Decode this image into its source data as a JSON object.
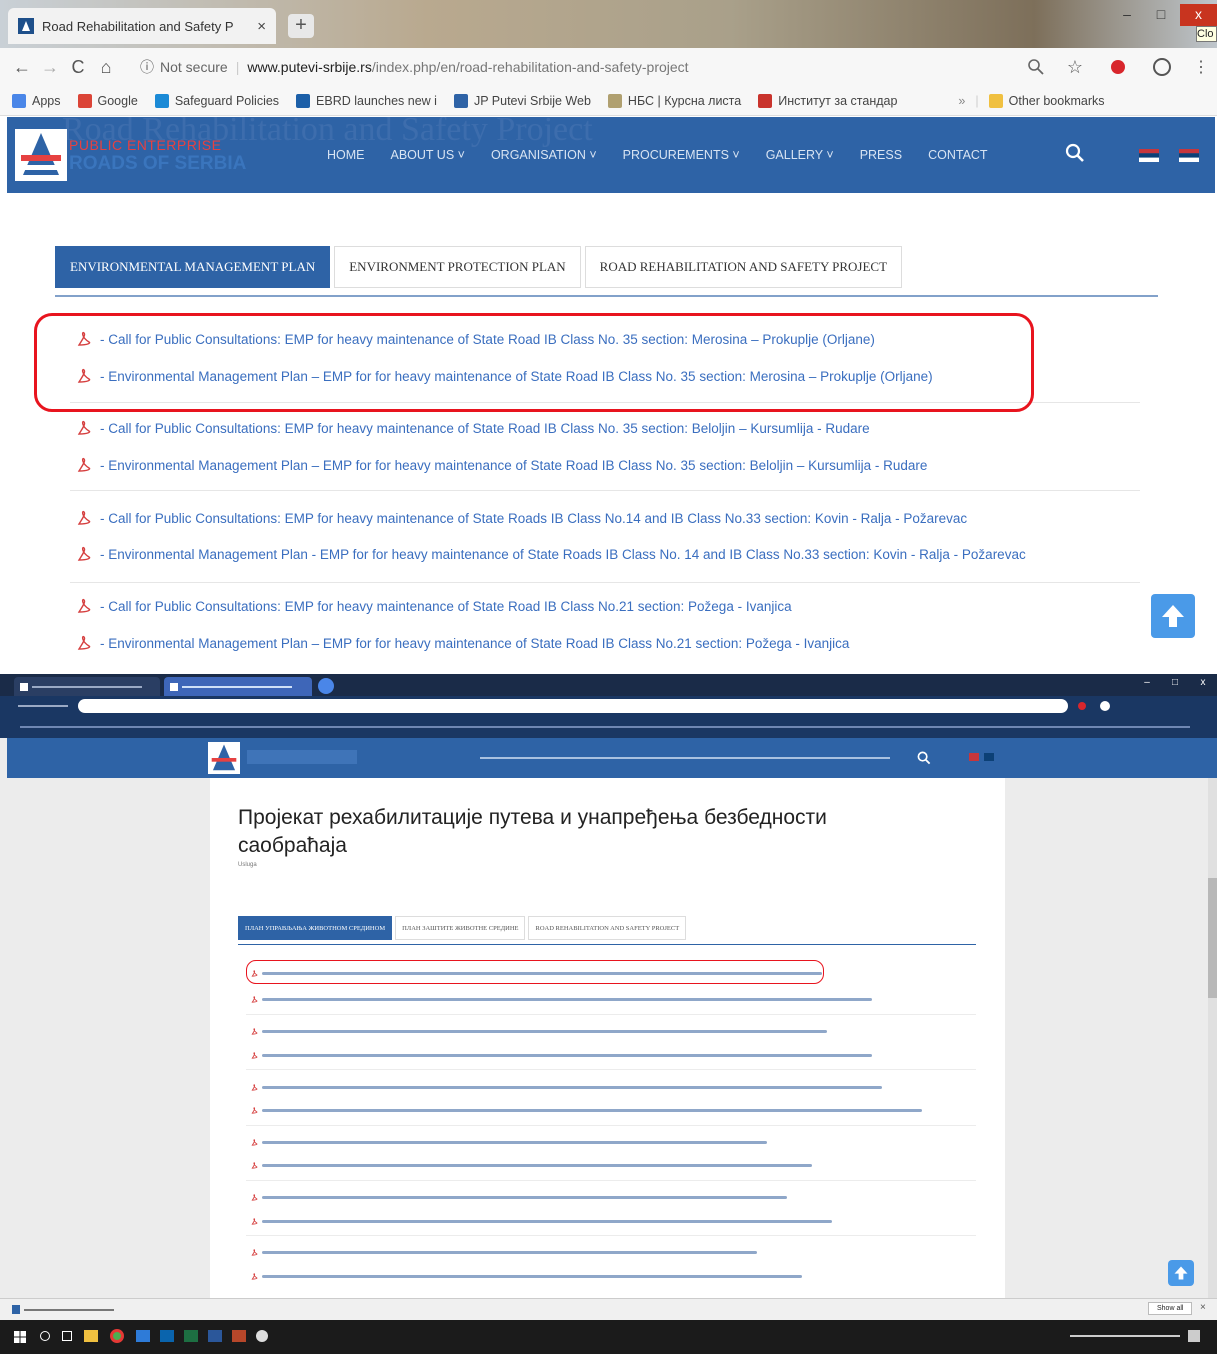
{
  "top_browser": {
    "tab_title": "Road Rehabilitation and Safety P",
    "tab_close": "×",
    "new_tab": "+",
    "window_controls": [
      "–",
      "□",
      "x"
    ],
    "corner_label": "Clo",
    "nav": {
      "back": "←",
      "forward": "→",
      "reload": "C",
      "home": "⌂"
    },
    "address": {
      "info": "ⓘ",
      "not_secure": "Not secure",
      "domain": "www.putevi-srbije.rs",
      "path": "/index.php/en/road-rehabilitation-and-safety-project"
    },
    "bookmarks": [
      {
        "label": "Apps",
        "color": "#4a86e8"
      },
      {
        "label": "Google",
        "color": "#db4437"
      },
      {
        "label": "Safeguard Policies",
        "color": "#1b8ad6"
      },
      {
        "label": "EBRD launches new i",
        "color": "#1c5fa8"
      },
      {
        "label": "JP Putevi Srbije Web",
        "color": "#2e63a6"
      },
      {
        "label": "НБС | Курсна листа",
        "color": "#b0a070"
      },
      {
        "label": "Институт за стандар",
        "color": "#c9332c"
      }
    ],
    "bookmarks_more": "»",
    "other_bookmarks": "Other bookmarks"
  },
  "site": {
    "ghost_heading": "Road Rehabilitation and Safety Project",
    "logo_line1": "PUBLIC ENTERPRISE",
    "logo_line2": "ROADS OF SERBIA",
    "menu": [
      "HOME",
      "ABOUT US ˅",
      "ORGANISATION ˅",
      "PROCUREMENTS ˅",
      "GALLERY ˅",
      "PRESS",
      "CONTACT"
    ],
    "tabs": [
      {
        "label": "ENVIRONMENTAL MANAGEMENT PLAN",
        "active": true
      },
      {
        "label": "ENVIRONMENT PROTECTION PLAN",
        "active": false
      },
      {
        "label": "ROAD REHABILITATION AND SAFETY PROJECT",
        "active": false
      }
    ],
    "documents": [
      "- Call for Public Consultations: EMP for heavy maintenance of State Road IB Class No. 35 section: Merosina – Prokuplje (Orljane)",
      "- Environmental Management Plan – EMP for for heavy maintenance of State Road IB Class No. 35 section: Merosina – Prokuplje (Orljane)",
      "- Call for Public Consultations: EMP for heavy maintenance of State Road IB Class No. 35 section: Beloljin – Kursumlija - Rudare",
      "- Environmental Management Plan – EMP for for heavy maintenance of State Road IB Class No. 35 section: Beloljin – Kursumlija - Rudare",
      "- Call for Public Consultations: EMP for heavy maintenance of State Roads IB Class No.14 and IB Class No.33 section: Kovin - Ralja - Požarevac",
      "- Environmental Management Plan - EMP for for heavy maintenance of State Roads IB Class No. 14 and IB Class No.33 section: Kovin - Ralja - Požarevac",
      "- Call for Public Consultations: EMP for heavy maintenance of State Road IB Class No.21 section: Požega - Ivanjica",
      "- Environmental Management Plan – EMP for for heavy maintenance of State Road IB Class No.21 section: Požega - Ivanjica"
    ]
  },
  "bottom_browser": {
    "page_title": "Пројекат рехабилитације путева и унапређења безбедности саобраћаја",
    "breadcrumb": "Usluga",
    "tabs": [
      {
        "label": "ПЛАН УПРАВЉАЊА ЖИВОТНОМ СРЕДИНОМ",
        "active": true
      },
      {
        "label": "ПЛАН ЗАШТИТЕ ЖИВОТНЕ СРЕДИНЕ",
        "active": false
      },
      {
        "label": "ROAD REHABILITATION AND SAFETY PROJECT",
        "active": false
      }
    ],
    "download_show_all": "Show all",
    "download_close": "×",
    "window_controls": [
      "–",
      "□",
      "x"
    ]
  },
  "colors": {
    "brand_blue": "#2e63a6",
    "link_blue": "#3a6ebf",
    "highlight_red": "#e8141e",
    "scroll_button": "#4a9ae8"
  }
}
